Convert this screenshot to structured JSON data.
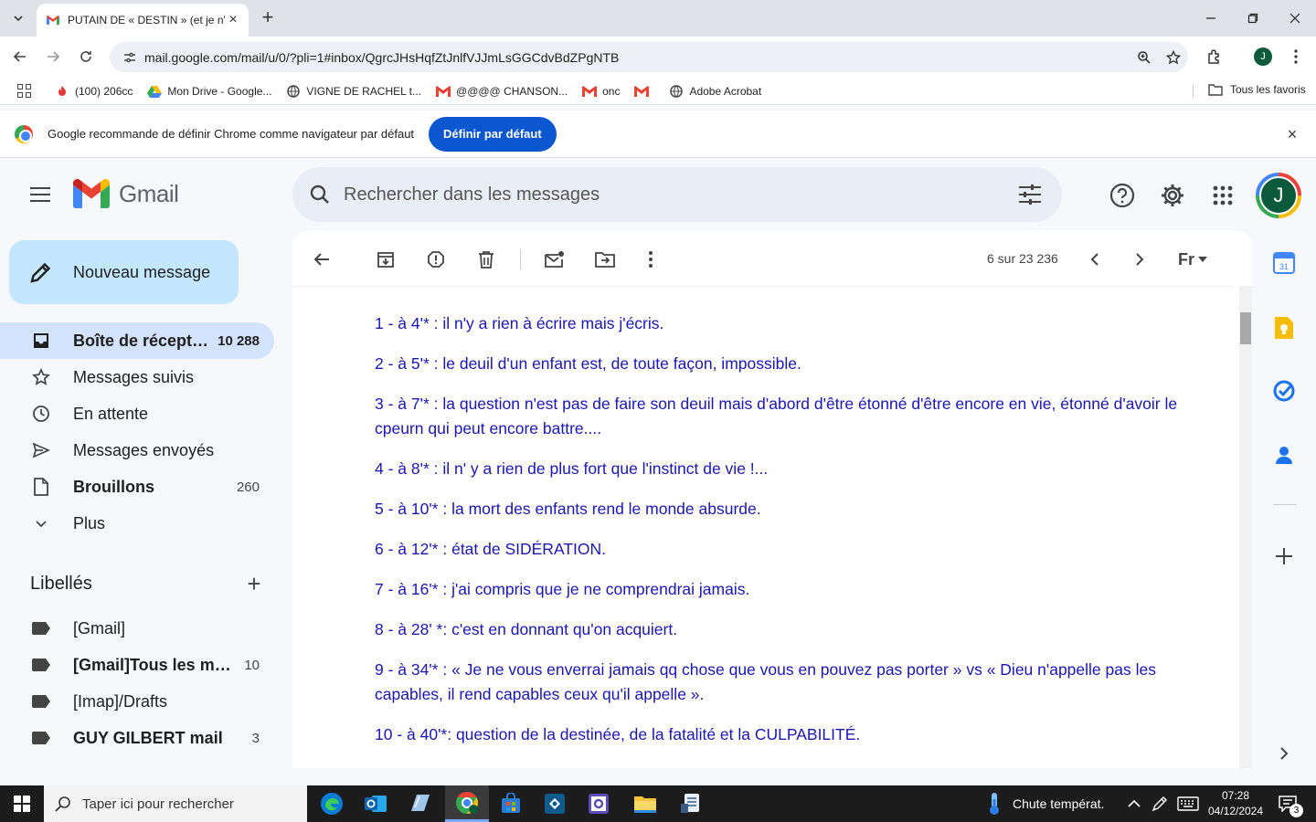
{
  "browser": {
    "tab_title": "PUTAIN DE « DESTIN » (et je n'écris",
    "url": "mail.google.com/mail/u/0/?pli=1#inbox/QgrcJHsHqfZtJnlfVJJmLsGGCdvBdZPgNTB",
    "profile_initial": "J",
    "bookmarks": [
      {
        "label": "(100) 206cc",
        "icon": "flame-icon"
      },
      {
        "label": "Mon Drive - Google...",
        "icon": "drive-icon"
      },
      {
        "label": "VIGNE DE RACHEL t...",
        "icon": "globe-icon"
      },
      {
        "label": "@@@@ CHANSON...",
        "icon": "gmail-icon"
      },
      {
        "label": "onc",
        "icon": "gmail-icon"
      },
      {
        "label": "",
        "icon": "gmail-icon"
      },
      {
        "label": "Adobe Acrobat",
        "icon": "globe-icon"
      }
    ],
    "all_bookmarks": "Tous les favoris",
    "infobar_text": "Google recommande de définir Chrome comme navigateur par défaut",
    "infobar_button": "Définir par défaut"
  },
  "gmail": {
    "brand": "Gmail",
    "search_placeholder": "Rechercher dans les messages",
    "compose_label": "Nouveau message",
    "nav": [
      {
        "label": "Boîte de réception",
        "count": "10 288",
        "bold": true,
        "active": true,
        "icon": "inbox-icon"
      },
      {
        "label": "Messages suivis",
        "count": "",
        "bold": false,
        "active": false,
        "icon": "star-icon"
      },
      {
        "label": "En attente",
        "count": "",
        "bold": false,
        "active": false,
        "icon": "clock-icon"
      },
      {
        "label": "Messages envoyés",
        "count": "",
        "bold": false,
        "active": false,
        "icon": "send-icon"
      },
      {
        "label": "Brouillons",
        "count": "260",
        "bold": true,
        "active": false,
        "icon": "draft-icon"
      },
      {
        "label": "Plus",
        "count": "",
        "bold": false,
        "active": false,
        "icon": "chevron-down-icon"
      }
    ],
    "labels_title": "Libellés",
    "labels": [
      {
        "label": "[Gmail]",
        "count": "",
        "bold": false
      },
      {
        "label": "[Gmail]Tous les messages",
        "count": "10",
        "bold": true
      },
      {
        "label": "[Imap]/Drafts",
        "count": "",
        "bold": false
      },
      {
        "label": "GUY GILBERT mail",
        "count": "3",
        "bold": true
      }
    ],
    "pager": "6 sur 23 236",
    "language_label": "Fr",
    "message_lines": [
      "1 - à 4'* : il n'y a rien à écrire mais j'écris.",
      "2 - à 5'* : le deuil d'un enfant est, de toute façon, impossible.",
      "3 - à 7'* : la question n'est pas de faire son deuil mais d'abord d'être étonné d'être encore en vie, étonné d'avoir le cpeurn qui peut encore battre....",
      "4 - à 8'* : il n' y a rien de plus fort que l'instinct de vie !...",
      "5 - à 10'* : la mort des enfants rend le monde absurde.",
      "6 - à 12'* : état de SIDÉRATION.",
      "7 - à 16'* : j'ai compris que je ne comprendrai jamais.",
      "8 - à 28' *: c'est en donnant qu'on acquiert.",
      "9 - à 34'* : « Je ne vous enverrai jamais qq chose que vous en pouvez pas porter » vs « Dieu n'appelle pas les capables, il rend capables ceux qu'il appelle ».",
      "10 - à 40'*: question de la destinée, de la fatalité et la CULPABILITÉ."
    ]
  },
  "taskbar": {
    "search_placeholder": "Taper ici pour rechercher",
    "weather": "Chute températ.",
    "time": "07:28",
    "date": "04/12/2024",
    "notifications": "3"
  },
  "colors": {
    "accent": "#0b57d0",
    "compose_bg": "#c2e7ff",
    "active_nav": "#d3e3fd",
    "message_text": "#1a17b0",
    "avatar": "#0b5a3e"
  }
}
